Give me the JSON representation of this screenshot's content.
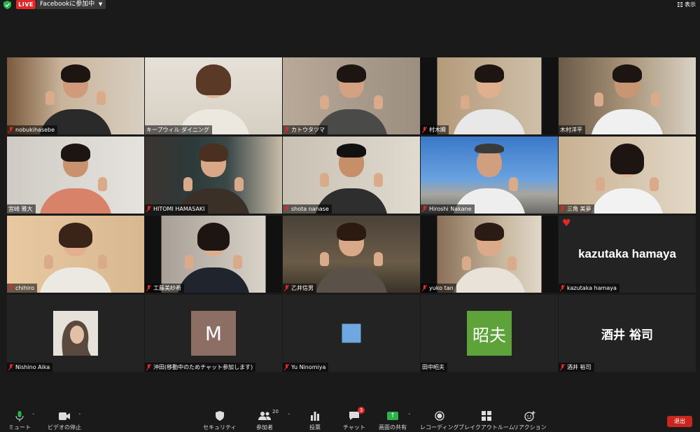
{
  "topbar": {
    "live_label": "LIVE",
    "facebook_status": "Facebookに参加中",
    "view_label": "表示"
  },
  "tiles": [
    {
      "name": "nobukihasebe",
      "muted": true
    },
    {
      "name": "キープウィル ダイニング",
      "muted": false,
      "active": true
    },
    {
      "name": "カトウタツマ",
      "muted": true
    },
    {
      "name": "村木瞬",
      "muted": true
    },
    {
      "name": "木村洋平",
      "muted": false
    },
    {
      "name": "宮崎 雅大",
      "muted": false
    },
    {
      "name": "HITOMI HAMASAKI",
      "muted": true
    },
    {
      "name": "shota nanase",
      "muted": true
    },
    {
      "name": "Hiroshi Nakane",
      "muted": true
    },
    {
      "name": "三角 美夢",
      "muted": true
    },
    {
      "name": "chihiro",
      "muted": true
    },
    {
      "name": "工藤美紗希",
      "muted": true
    },
    {
      "name": "乙井信男",
      "muted": true
    },
    {
      "name": "yuko tan",
      "muted": true
    },
    {
      "name": "kazutaka hamaya",
      "muted": true,
      "display_name": "kazutaka hamaya",
      "reaction": "heart"
    },
    {
      "name": "Nishino Aika",
      "muted": true
    },
    {
      "name": "沖田(移動中のためチャット参加します)",
      "muted": true,
      "avatar_letter": "M"
    },
    {
      "name": "Yu Ninomiya",
      "muted": true
    },
    {
      "name": "田中昭夫",
      "muted": false,
      "avatar_text": "昭夫"
    },
    {
      "name": "酒井 裕司",
      "muted": true,
      "display_name": "酒井 裕司"
    }
  ],
  "toolbar": {
    "mute_label": "ミュート",
    "video_label": "ビデオの停止",
    "security_label": "セキュリティ",
    "participants_label": "参加者",
    "participants_count": "20",
    "polls_label": "投票",
    "chat_label": "チャット",
    "chat_badge": "3",
    "share_label": "画面の共有",
    "record_label": "レコーディング",
    "breakout_label": "ブレイクアウトルーム",
    "reactions_label": "リアクション",
    "leave_label": "退出"
  },
  "colors": {
    "live": "#e02828",
    "active_speaker": "#c8e63c",
    "share": "#2bb24c",
    "leave": "#c8261e",
    "avatar_m": "#8d6e64",
    "avatar_kanji": "#5ea33a",
    "avatar_square": "#6fa8e0"
  }
}
